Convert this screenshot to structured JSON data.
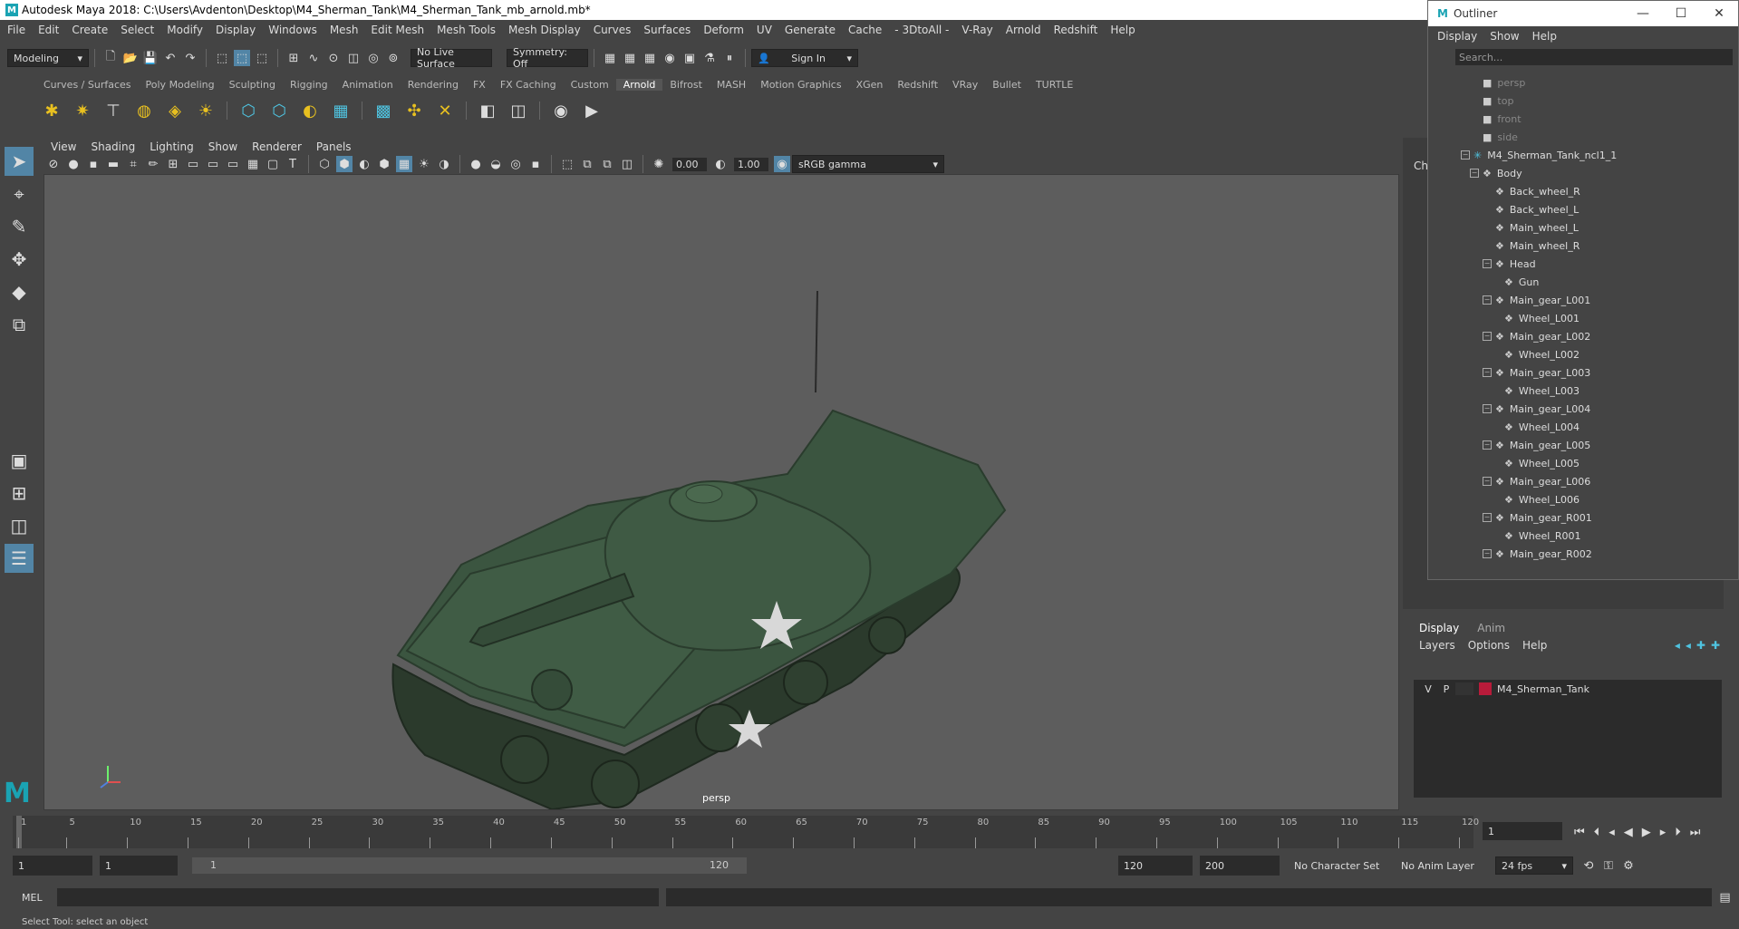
{
  "window": {
    "title": "Autodesk Maya 2018: C:\\Users\\Avdenton\\Desktop\\M4_Sherman_Tank\\M4_Sherman_Tank_mb_arnold.mb*"
  },
  "menubar": [
    "File",
    "Edit",
    "Create",
    "Select",
    "Modify",
    "Display",
    "Windows",
    "Mesh",
    "Edit Mesh",
    "Mesh Tools",
    "Mesh Display",
    "Curves",
    "Surfaces",
    "Deform",
    "UV",
    "Generate",
    "Cache",
    "- 3DtoAll -",
    "V-Ray",
    "Arnold",
    "Redshift",
    "Help"
  ],
  "statusline": {
    "mode": "Modeling",
    "live_surface": "No Live Surface",
    "symmetry": "Symmetry: Off",
    "sign_in": "Sign In"
  },
  "shelf_tabs": [
    "Curves / Surfaces",
    "Poly Modeling",
    "Sculpting",
    "Rigging",
    "Animation",
    "Rendering",
    "FX",
    "FX Caching",
    "Custom",
    "Arnold",
    "Bifrost",
    "MASH",
    "Motion Graphics",
    "XGen",
    "Redshift",
    "VRay",
    "Bullet",
    "TURTLE"
  ],
  "shelf_active": "Arnold",
  "viewport": {
    "menu": [
      "View",
      "Shading",
      "Lighting",
      "Show",
      "Renderer",
      "Panels"
    ],
    "exposure": "0.00",
    "gamma": "1.00",
    "color_space": "sRGB gamma",
    "camera": "persp"
  },
  "outliner": {
    "title": "Outliner",
    "menu": [
      "Display",
      "Show",
      "Help"
    ],
    "search_placeholder": "Search...",
    "items": [
      {
        "label": "persp",
        "depth": 1,
        "kind": "camera"
      },
      {
        "label": "top",
        "depth": 1,
        "kind": "camera"
      },
      {
        "label": "front",
        "depth": 1,
        "kind": "camera"
      },
      {
        "label": "side",
        "depth": 1,
        "kind": "camera"
      },
      {
        "label": "M4_Sherman_Tank_ncl1_1",
        "depth": 0,
        "kind": "root"
      },
      {
        "label": "Body",
        "depth": 1,
        "kind": "group"
      },
      {
        "label": "Back_wheel_R",
        "depth": 2,
        "kind": "mesh"
      },
      {
        "label": "Back_wheel_L",
        "depth": 2,
        "kind": "mesh"
      },
      {
        "label": "Main_wheel_L",
        "depth": 2,
        "kind": "mesh"
      },
      {
        "label": "Main_wheel_R",
        "depth": 2,
        "kind": "mesh"
      },
      {
        "label": "Head",
        "depth": 2,
        "kind": "group"
      },
      {
        "label": "Gun",
        "depth": 3,
        "kind": "mesh"
      },
      {
        "label": "Main_gear_L001",
        "depth": 2,
        "kind": "group"
      },
      {
        "label": "Wheel_L001",
        "depth": 3,
        "kind": "mesh"
      },
      {
        "label": "Main_gear_L002",
        "depth": 2,
        "kind": "group"
      },
      {
        "label": "Wheel_L002",
        "depth": 3,
        "kind": "mesh"
      },
      {
        "label": "Main_gear_L003",
        "depth": 2,
        "kind": "group"
      },
      {
        "label": "Wheel_L003",
        "depth": 3,
        "kind": "mesh"
      },
      {
        "label": "Main_gear_L004",
        "depth": 2,
        "kind": "group"
      },
      {
        "label": "Wheel_L004",
        "depth": 3,
        "kind": "mesh"
      },
      {
        "label": "Main_gear_L005",
        "depth": 2,
        "kind": "group"
      },
      {
        "label": "Wheel_L005",
        "depth": 3,
        "kind": "mesh"
      },
      {
        "label": "Main_gear_L006",
        "depth": 2,
        "kind": "group"
      },
      {
        "label": "Wheel_L006",
        "depth": 3,
        "kind": "mesh"
      },
      {
        "label": "Main_gear_R001",
        "depth": 2,
        "kind": "group"
      },
      {
        "label": "Wheel_R001",
        "depth": 3,
        "kind": "mesh"
      },
      {
        "label": "Main_gear_R002",
        "depth": 2,
        "kind": "group"
      }
    ]
  },
  "layer_editor": {
    "tabs": [
      "Display",
      "Anim"
    ],
    "menu": [
      "Layers",
      "Options",
      "Help"
    ],
    "layers": [
      {
        "v": "V",
        "p": "P",
        "name": "M4_Sherman_Tank",
        "color": "#b81b3a"
      }
    ]
  },
  "timeline": {
    "ticks": [
      "1",
      "5",
      "10",
      "15",
      "20",
      "25",
      "30",
      "35",
      "40",
      "45",
      "50",
      "55",
      "60",
      "65",
      "70",
      "75",
      "80",
      "85",
      "90",
      "95",
      "100",
      "105",
      "110",
      "115",
      "120"
    ],
    "current_frame": "1"
  },
  "range": {
    "start": "1",
    "playback_start": "1",
    "slider_start": "1",
    "slider_end": "120",
    "playback_end": "120",
    "end": "200",
    "character_set": "No Character Set",
    "anim_layer": "No Anim Layer",
    "fps": "24 fps"
  },
  "cmdline": {
    "label": "MEL"
  },
  "helpline": "Select Tool: select an object",
  "channel_box_label": "Ch"
}
